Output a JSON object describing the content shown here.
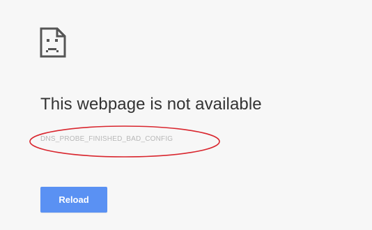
{
  "error": {
    "icon": "sad-page-icon",
    "title": "This webpage is not available",
    "code": "DNS_PROBE_FINISHED_BAD_CONFIG"
  },
  "actions": {
    "reload_label": "Reload"
  },
  "annotation": {
    "shape": "ellipse",
    "color": "#d9262e"
  },
  "colors": {
    "background": "#f7f7f7",
    "title": "#333333",
    "code": "#b8b8b8",
    "button": "#5a91f3",
    "button_text": "#ffffff",
    "icon": "#555555"
  }
}
